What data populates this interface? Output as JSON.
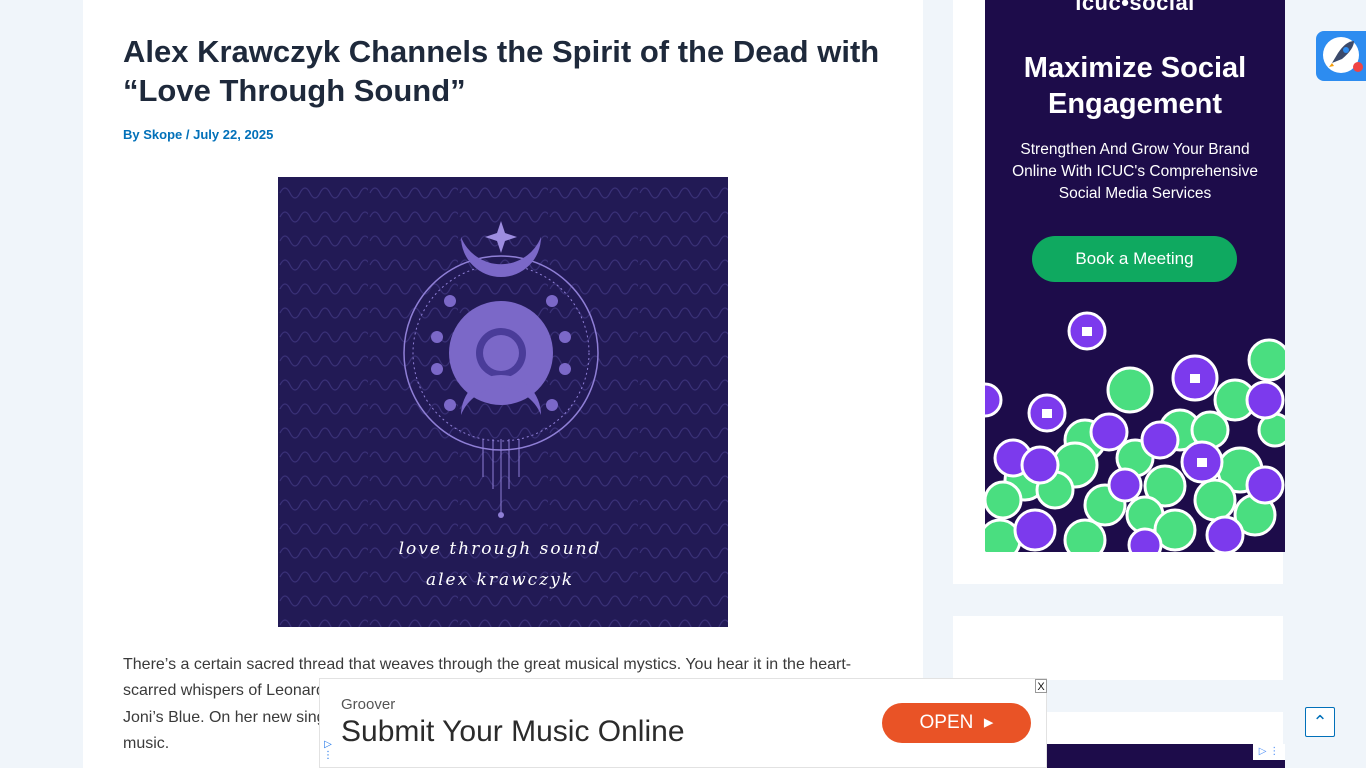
{
  "article": {
    "title": "Alex Krawczyk Channels the Spirit of the Dead with “Love Through Sound”",
    "by_label": "By",
    "author": "Skope",
    "separator": "/",
    "date": "July 22, 2025",
    "cover": {
      "line1": "love through sound",
      "line2": "alex krawczyk"
    },
    "body": "There’s a certain sacred thread that weaves through the great musical mystics. You hear it in the heart-scarred whispers of Leonard Cohen, in the haunted poetry of Nick Drake, in the confessional ache of Joni’s Blue. On her new single, Alex Krawczyk takes that thread and gently runs it through her own music."
  },
  "sidebar_ad": {
    "logo": "icuc•social",
    "headline": "Maximize Social Engagement",
    "subtext": "Strengthen And Grow Your Brand Online With ICUC's Comprehensive Social Media Services",
    "button_label": "Book a Meeting"
  },
  "bottom_ad": {
    "close_label": "X",
    "brand": "Groover",
    "headline": "Submit Your Music Online",
    "button_label": "OPEN"
  },
  "colors": {
    "link": "#0170b9",
    "ad_purple": "#1d0c4a",
    "ad_green": "#0fa960",
    "ad_orange": "#e95326"
  },
  "icons": {
    "rocket": "rocket-icon",
    "scroll_top": "chevron-up-icon",
    "ad_choices": "ad-choices-icon"
  }
}
